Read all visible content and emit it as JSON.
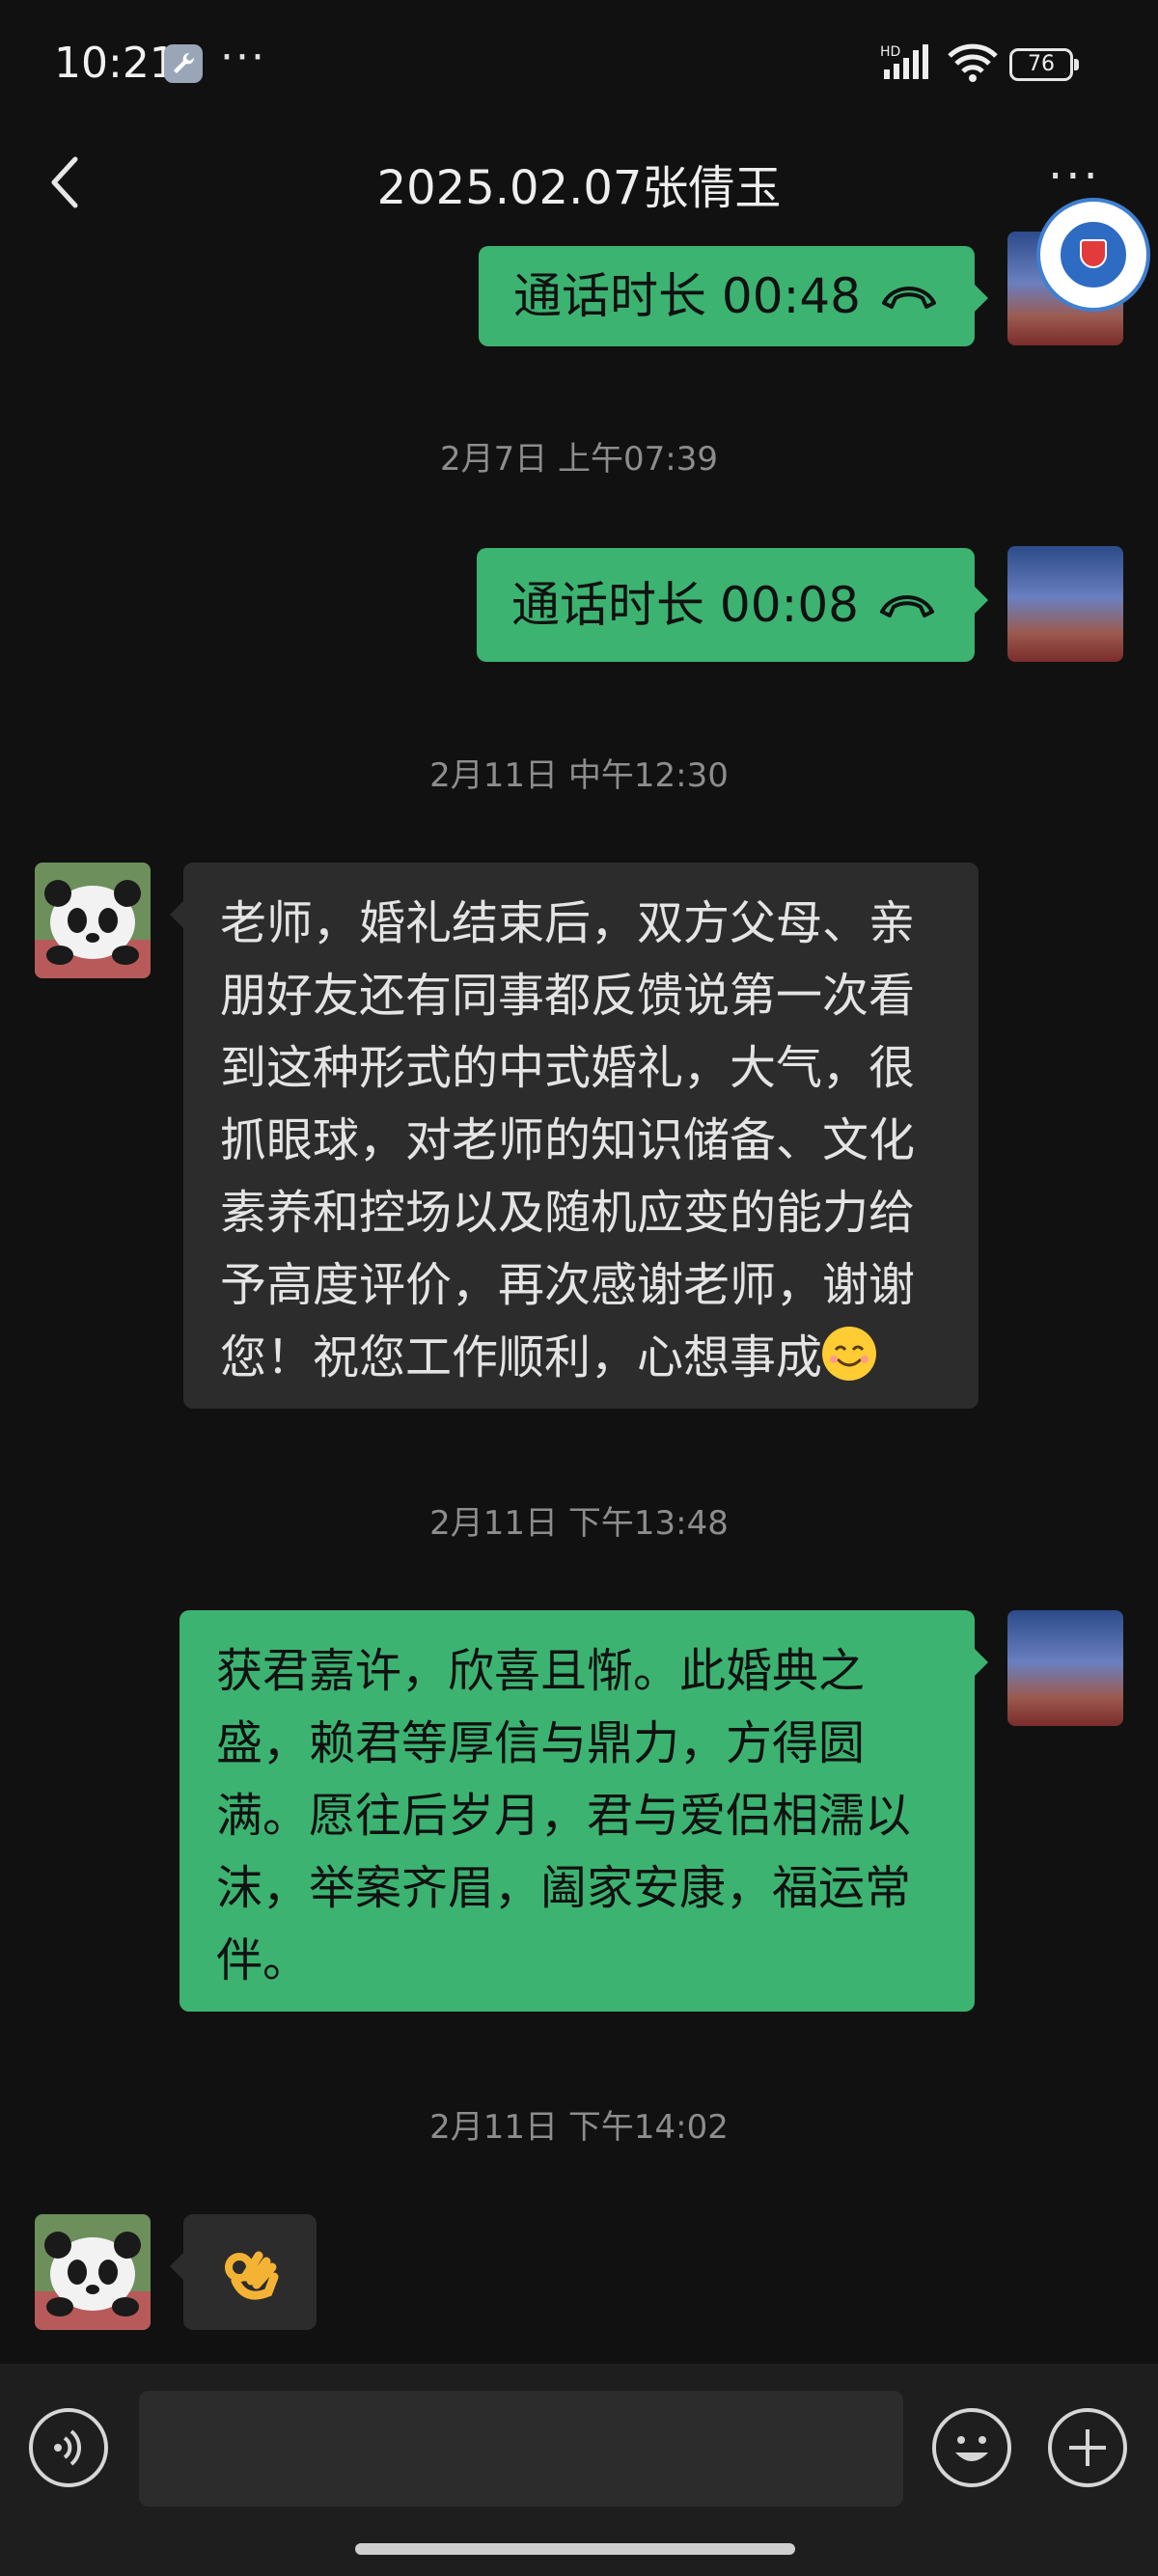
{
  "status_bar": {
    "time": "10:21",
    "more": "···",
    "battery": "76",
    "network": "HD"
  },
  "header": {
    "title": "2025.02.07张倩玉",
    "more": "···"
  },
  "messages": [
    {
      "type": "timestamp",
      "text": "2月7日 上午07:39"
    },
    {
      "type": "timestamp",
      "text": "2月11日 中午12:30"
    },
    {
      "type": "timestamp",
      "text": "2月11日 下午13:48"
    },
    {
      "type": "timestamp",
      "text": "2月11日 下午14:02"
    }
  ],
  "calls": [
    {
      "label": "通话时长 00:48"
    },
    {
      "label": "通话时长 00:08"
    }
  ],
  "incoming1": {
    "lines": [
      "老师，婚礼结束后，双方父母、亲",
      "朋好友还有同事都反馈说第一次看",
      "到这种形式的中式婚礼，大气，很",
      "抓眼球，对老师的知识储备、文化",
      "素养和控场以及随机应变的能力给",
      "予高度评价，再次感谢老师，谢谢",
      "您！祝您工作顺利，心想事成"
    ],
    "emoji": "smiling-face-emoji"
  },
  "outgoing1": {
    "lines": [
      "获君嘉许，欣喜且惭。此婚典之",
      "盛，赖君等厚信与鼎力，方得圆",
      "满。愿往后岁月，君与爱侣相濡以",
      "沫，举案齐眉，阖家安康，福运常",
      "伴。"
    ]
  },
  "incoming2": {
    "emoji": "ok-hand-emoji"
  },
  "input": {
    "placeholder": ""
  },
  "colors": {
    "outgoing_bubble": "#3cb371",
    "incoming_bubble": "#2c2c2c",
    "background": "#111111"
  }
}
